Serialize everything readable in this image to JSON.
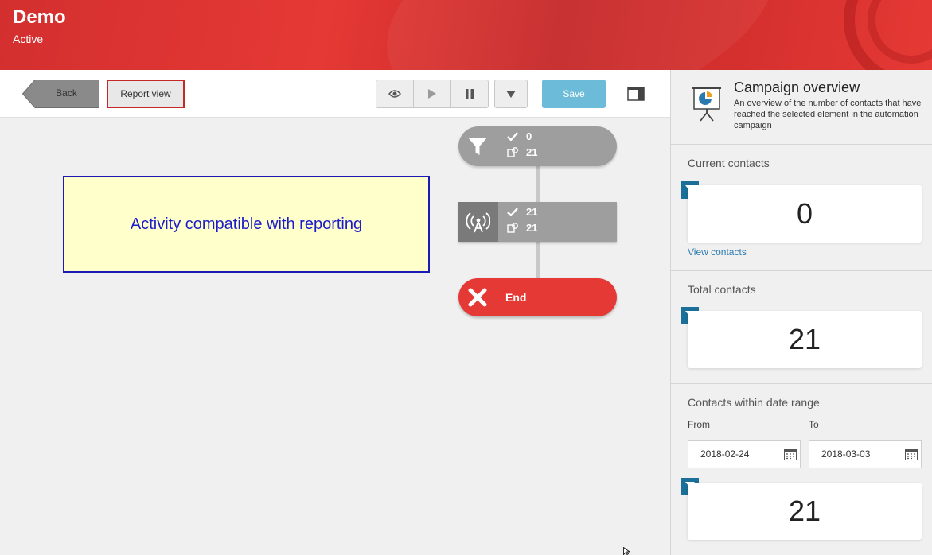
{
  "header": {
    "title": "Demo",
    "status": "Active"
  },
  "toolbar": {
    "back_label": "Back",
    "report_view_label": "Report view",
    "save_label": "Save"
  },
  "canvas": {
    "note_text": "Activity compatible with reporting",
    "trigger_node": {
      "icon": "funnel-icon",
      "passed": "0",
      "total": "21"
    },
    "activity_node": {
      "icon": "broadcast-icon",
      "passed": "21",
      "total": "21"
    },
    "end_node": {
      "label": "End"
    }
  },
  "panel": {
    "title": "Campaign overview",
    "description": "An overview of the number of contacts that have reached the selected element in the automation campaign",
    "current": {
      "label": "Current contacts",
      "value": "0",
      "link": "View contacts"
    },
    "total": {
      "label": "Total contacts",
      "value": "21"
    },
    "range": {
      "label": "Contacts within date range",
      "from_label": "From",
      "to_label": "To",
      "from_value": "2018-02-24",
      "to_value": "2018-03-03",
      "value": "21"
    }
  },
  "colors": {
    "header": "#e53935",
    "save": "#6cbcd9",
    "end_node": "#e53935",
    "node": "#9e9e9e",
    "filter_badge": "#1b6f98"
  }
}
